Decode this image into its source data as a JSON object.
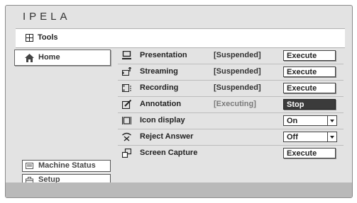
{
  "app": {
    "logo": "IPELA"
  },
  "toolbar": {
    "label": "Tools",
    "icon": "grid-icon"
  },
  "sidebar": {
    "home": {
      "label": "Home",
      "icon": "home-icon"
    },
    "machine_status": {
      "label": "Machine Status",
      "icon": "monitor-icon"
    },
    "setup": {
      "label": "Setup",
      "icon": "toolbox-icon"
    }
  },
  "functions": [
    {
      "name": "Presentation",
      "state": "[Suspended]",
      "control": "Execute",
      "icon": "presentation-icon"
    },
    {
      "name": "Streaming",
      "state": "[Suspended]",
      "control": "Execute",
      "icon": "streaming-icon"
    },
    {
      "name": "Recording",
      "state": "[Suspended]",
      "control": "Execute",
      "icon": "recording-icon"
    },
    {
      "name": "Annotation",
      "state": "[Executing]",
      "control": "Stop",
      "icon": "annotation-icon"
    },
    {
      "name": "Icon display",
      "state": "",
      "control": "On",
      "icon": "icon-display-icon"
    },
    {
      "name": "Reject Answer",
      "state": "",
      "control": "Off",
      "icon": "reject-icon"
    },
    {
      "name": "Screen Capture",
      "state": "",
      "control": "Execute",
      "icon": "screen-capture-icon"
    }
  ]
}
